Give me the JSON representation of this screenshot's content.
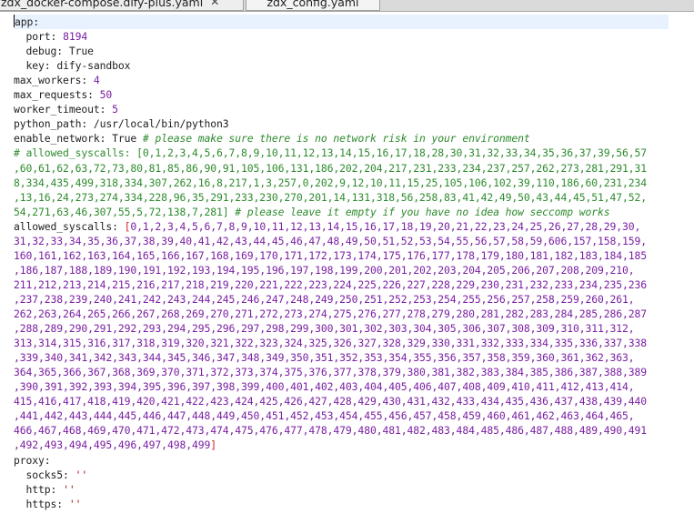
{
  "tabs": [
    {
      "label": "zdx_docker-compose.dify-plus.yaml",
      "close": "✕"
    },
    {
      "label": "zdx_config.yaml"
    }
  ],
  "lines": [
    {
      "key": "app:",
      "cursor": true
    },
    {
      "key": "  port: ",
      "num": "8194"
    },
    {
      "key": "  debug: ",
      "val": "True"
    },
    {
      "key": "  key: ",
      "val": "dify-sandbox"
    },
    {
      "key": "max_workers: ",
      "num": "4"
    },
    {
      "key": "max_requests: ",
      "num": "50"
    },
    {
      "key": "worker_timeout: ",
      "num": "5"
    },
    {
      "key": "python_path: ",
      "val": "/usr/local/bin/python3"
    },
    {
      "key": "enable_network: ",
      "val": "True ",
      "comment": "# please make sure there is no network risk in your environment"
    },
    {
      "comment2": "# allowed_syscalls: [0,1,2,3,4,5,6,7,8,9,10,11,12,13,14,15,16,17,18,28,30,31,32,33,34,35,36,37,39,56,57"
    },
    {
      "comment2": ",60,61,62,63,72,73,80,81,85,86,90,91,105,106,131,186,202,204,217,231,233,234,237,257,262,273,281,291,31"
    },
    {
      "comment2": "8,334,435,499,318,334,307,262,16,8,217,1,3,257,0,202,9,12,10,11,15,25,105,106,102,39,110,186,60,231,234"
    },
    {
      "comment2": ",13,16,24,273,274,334,228,96,35,291,233,230,270,201,14,131,318,56,258,83,41,42,49,50,43,44,45,51,47,52,"
    },
    {
      "comment2": "54,271,63,46,307,55,5,72,138,7,281] ",
      "comment": "# please leave it empty if you have no idea how seccomp works"
    },
    {
      "key": "allowed_syscalls: ",
      "open": "[",
      "arr": "0,1,2,3,4,5,6,7,8,9,10,11,12,13,14,15,16,17,18,19,20,21,22,23,24,25,26,27,28,29,30,"
    },
    {
      "arr": "31,32,33,34,35,36,37,38,39,40,41,42,43,44,45,46,47,48,49,50,51,52,53,54,55,56,57,58,59,606,157,158,159,"
    },
    {
      "arr": "160,161,162,163,164,165,166,167,168,169,170,171,172,173,174,175,176,177,178,179,180,181,182,183,184,185"
    },
    {
      "arr": ",186,187,188,189,190,191,192,193,194,195,196,197,198,199,200,201,202,203,204,205,206,207,208,209,210,"
    },
    {
      "arr": "211,212,213,214,215,216,217,218,219,220,221,222,223,224,225,226,227,228,229,230,231,232,233,234,235,236"
    },
    {
      "arr": ",237,238,239,240,241,242,243,244,245,246,247,248,249,250,251,252,253,254,255,256,257,258,259,260,261,"
    },
    {
      "arr": "262,263,264,265,266,267,268,269,270,271,272,273,274,275,276,277,278,279,280,281,282,283,284,285,286,287"
    },
    {
      "arr": ",288,289,290,291,292,293,294,295,296,297,298,299,300,301,302,303,304,305,306,307,308,309,310,311,312,"
    },
    {
      "arr": "313,314,315,316,317,318,319,320,321,322,323,324,325,326,327,328,329,330,331,332,333,334,335,336,337,338"
    },
    {
      "arr": ",339,340,341,342,343,344,345,346,347,348,349,350,351,352,353,354,355,356,357,358,359,360,361,362,363,"
    },
    {
      "arr": "364,365,366,367,368,369,370,371,372,373,374,375,376,377,378,379,380,381,382,383,384,385,386,387,388,389"
    },
    {
      "arr": ",390,391,392,393,394,395,396,397,398,399,400,401,402,403,404,405,406,407,408,409,410,411,412,413,414,"
    },
    {
      "arr": "415,416,417,418,419,420,421,422,423,424,425,426,427,428,429,430,431,432,433,434,435,436,437,438,439,440"
    },
    {
      "arr": ",441,442,443,444,445,446,447,448,449,450,451,452,453,454,455,456,457,458,459,460,461,462,463,464,465,"
    },
    {
      "arr": "466,467,468,469,470,471,472,473,474,475,476,477,478,479,480,481,482,483,484,485,486,487,488,489,490,491"
    },
    {
      "arr": ",492,493,494,495,496,497,498,499",
      "close": "]"
    },
    {
      "key": "proxy:"
    },
    {
      "key": "  socks5: ",
      "str": "''"
    },
    {
      "key": "  http: ",
      "str": "''"
    },
    {
      "key": "  https: ",
      "str": "''"
    }
  ]
}
